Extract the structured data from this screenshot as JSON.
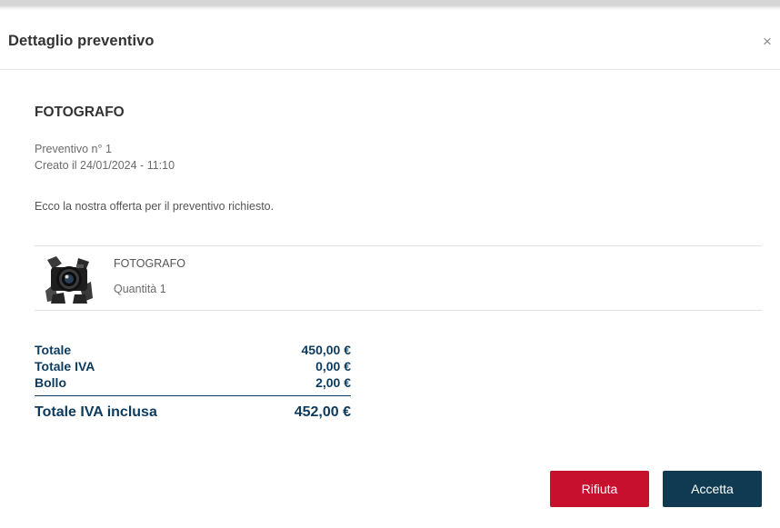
{
  "modal": {
    "title": "Dettaglio preventivo",
    "close_label": "×"
  },
  "quote": {
    "vendor": "FOTOGRAFO",
    "number": "Preventivo n° 1",
    "created": "Creato il 24/01/2024 - 11:10",
    "message": "Ecco la nostra offerta per il preventivo richiesto."
  },
  "item": {
    "name": "FOTOGRAFO",
    "quantity": "Quantità  1",
    "image_icon": "camera-photo-thumbnail"
  },
  "totals": {
    "rows": [
      {
        "label": "Totale",
        "value": "450,00 €"
      },
      {
        "label": "Totale IVA",
        "value": "0,00 €"
      },
      {
        "label": "Bollo",
        "value": "2,00 €"
      }
    ],
    "grand_label": "Totale IVA inclusa",
    "grand_value": "452,00 €"
  },
  "actions": {
    "reject_label": "Rifiuta",
    "accept_label": "Accetta"
  },
  "colors": {
    "accent_dark": "#0f3a52",
    "reject_red": "#c6102e",
    "total_text": "#0d3b5e"
  }
}
